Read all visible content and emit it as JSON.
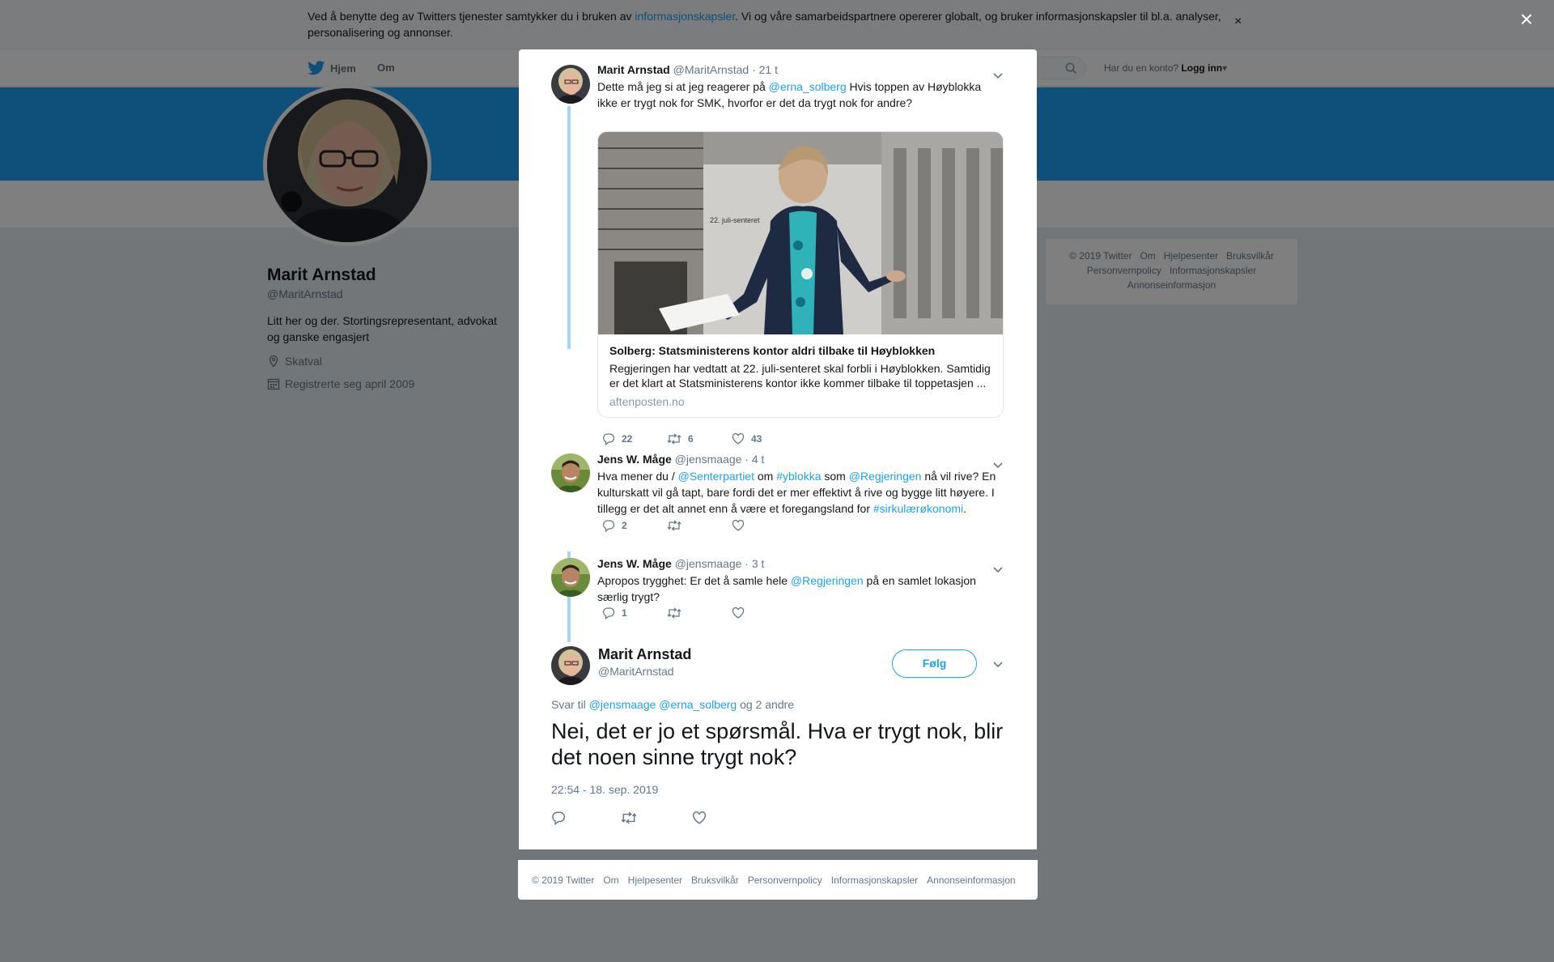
{
  "cookie": {
    "text_before": "Ved å benytte deg av Twitters tjenester samtykker du i bruken av ",
    "link": "informasjonskapsler",
    "text_after": ". Vi og våre samarbeidspartnere opererer globalt, og bruker informasjonskapsler til bl.a. analyser, personalisering og annonser.",
    "close": "×"
  },
  "nav": {
    "home": "Hjem",
    "about": "Om",
    "has_account": "Har du en konto?",
    "login": "Logg inn"
  },
  "profile": {
    "name": "Marit Arnstad",
    "handle": "@MaritArnstad",
    "bio": "Litt her og der. Stortingsrepresentant, advokat og ganske engasjert",
    "location": "Skatval",
    "joined": "Registrerte seg april 2009"
  },
  "side_footer": {
    "items_row1": [
      "© 2019 Twitter",
      "Om",
      "Hjelpesenter",
      "Bruksvilkår"
    ],
    "items_row2": [
      "Personvernpolicy",
      "Informasjonskapsler"
    ],
    "items_row3": [
      "Annonseinformasjon"
    ]
  },
  "overlay_close": "×",
  "thread": [
    {
      "name": "Marit Arnstad",
      "handle": "@MaritArnstad",
      "time": "· 21 t",
      "text_a": "Dette må jeg si at jeg reagerer på ",
      "mention": "@erna_solberg",
      "text_b": " Hvis toppen av Høyblokka ikke er trygt nok for SMK, hvorfor er det da trygt nok for andre?",
      "card": {
        "title": "Solberg: Statsministerens kontor aldri tilbake til Høyblokken",
        "description": "Regjeringen har vedtatt at 22. juli-senteret skal forbli i Høyblokken. Samtidig er det klart at Statsministerens kontor ikke kommer tilbake til toppetasjen ...",
        "domain": "aftenposten.no",
        "image_sign": "22. juli-senteret"
      },
      "replies": "22",
      "retweets": "6",
      "likes": "43"
    },
    {
      "name": "Jens W. Måge",
      "handle": "@jensmaage",
      "time": "· 4 t",
      "t1": "Hva mener du / ",
      "m1": "@Senterpartiet",
      "t2": " om ",
      "m2": "#yblokka",
      "t3": " som ",
      "m3": "@Regjeringen",
      "t4": " nå vil rive? En kulturskatt vil gå tapt, bare fordi det er mer effektivt å rive og bygge litt høyere. I tillegg er det alt annet enn å være et foregangsland for ",
      "m4": "#sirkulærøkonomi",
      "t5": ".",
      "replies": "2"
    },
    {
      "name": "Jens W. Måge",
      "handle": "@jensmaage",
      "time": "· 3 t",
      "t1": "Apropos trygghet: Er det å samle hele ",
      "m1": "@Regjeringen",
      "t2": " på en samlet lokasjon særlig trygt?",
      "replies": "1"
    }
  ],
  "focus": {
    "name": "Marit Arnstad",
    "handle": "@MaritArnstad",
    "follow": "Følg",
    "reply_label": "Svar til ",
    "reply_m1": "@jensmaage",
    "reply_m2": "@erna_solberg",
    "reply_rest": " og 2 andre",
    "text": "Nei, det er jo et spørsmål. Hva er trygt nok, blir det noen sinne trygt nok?",
    "timestamp": "22:54 - 18. sep. 2019"
  },
  "modal_footer": [
    "© 2019 Twitter",
    "Om",
    "Hjelpesenter",
    "Bruksvilkår",
    "Personvernpolicy",
    "Informasjonskapsler",
    "Annonseinformasjon"
  ],
  "colors": {
    "accent": "#1da1f2",
    "thread_line": "#a3d6f7",
    "overlay": "rgba(0,0,0,0.5)",
    "banner": "#1da1f2"
  },
  "icons": {
    "logo": "twitter-bird-icon",
    "search": "search-icon",
    "location": "location-pin-icon",
    "calendar": "calendar-icon",
    "reply": "reply-icon",
    "retweet": "retweet-icon",
    "like": "heart-icon",
    "more": "chevron-down-icon",
    "close": "close-icon"
  }
}
